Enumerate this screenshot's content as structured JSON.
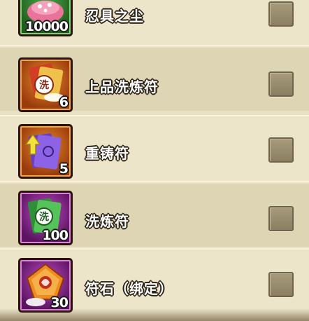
{
  "items": [
    {
      "name": "忍具之尘",
      "qty": "10000",
      "frame": "green",
      "icon": "pink-pouch-icon",
      "checked": false
    },
    {
      "name": "上品洗炼符",
      "qty": "6",
      "frame": "orange",
      "icon": "premium-refine-talisman-icon",
      "checked": false
    },
    {
      "name": "重铸符",
      "qty": "5",
      "frame": "orange",
      "icon": "reforge-talisman-icon",
      "checked": false
    },
    {
      "name": "洗炼符",
      "qty": "100",
      "frame": "purple",
      "icon": "refine-talisman-icon",
      "checked": false
    },
    {
      "name": "符石（绑定）",
      "qty": "30",
      "frame": "purple",
      "icon": "talisman-stone-icon",
      "checked": false
    }
  ]
}
